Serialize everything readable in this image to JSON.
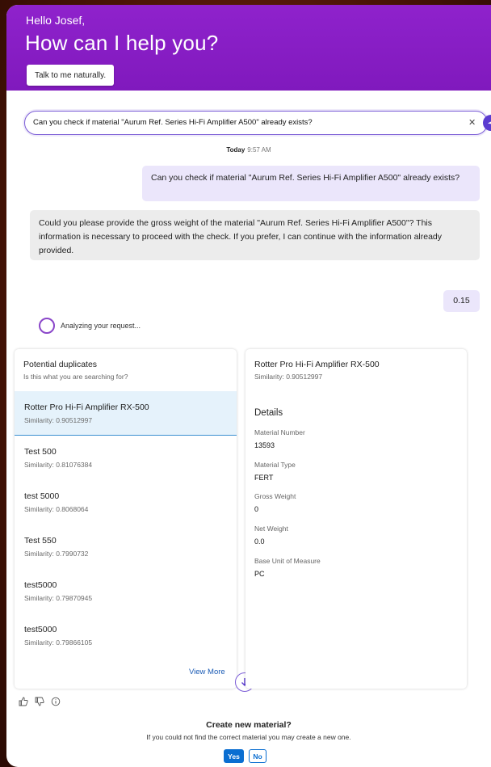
{
  "header": {
    "greeting": "Hello Josef,",
    "headline": "How can I help you?",
    "talk_button": "Talk to me naturally."
  },
  "search": {
    "value": "Can you check if material \"Aurum Ref. Series Hi-Fi Amplifier A500\" already exists?"
  },
  "conversation": {
    "day": "Today",
    "time": "9:57 AM",
    "user_message": "Can you check if material \"Aurum Ref. Series Hi-Fi Amplifier A500\" already exists?",
    "bot_message": "Could you please provide the gross weight of the material \"Aurum Ref. Series Hi-Fi Amplifier A500\"? This information is necessary to proceed with the check. If you prefer, I can continue with the information already provided.",
    "user_reply": "0.15",
    "status": "Analyzing your request..."
  },
  "duplicates": {
    "title": "Potential duplicates",
    "subtitle": "Is this what you are searching for?",
    "items": [
      {
        "name": "Rotter Pro Hi-Fi Amplifier RX-500",
        "similarity": "Similarity: 0.90512997"
      },
      {
        "name": "Test 500",
        "similarity": "Similarity: 0.81076384"
      },
      {
        "name": "test 5000",
        "similarity": "Similarity: 0.8068064"
      },
      {
        "name": "Test 550",
        "similarity": "Similarity: 0.7990732"
      },
      {
        "name": "test5000",
        "similarity": "Similarity: 0.79870945"
      },
      {
        "name": "test5000",
        "similarity": "Similarity: 0.79866105"
      }
    ],
    "view_more": "View More"
  },
  "details": {
    "title": "Rotter Pro Hi-Fi Amplifier RX-500",
    "subtitle": "Similarity: 0.90512997",
    "heading": "Details",
    "fields": [
      {
        "label": "Material Number",
        "value": "13593"
      },
      {
        "label": "Material Type",
        "value": "FERT"
      },
      {
        "label": "Gross Weight",
        "value": "0"
      },
      {
        "label": "Net Weight",
        "value": "0.0"
      },
      {
        "label": "Base Unit of Measure",
        "value": "PC"
      }
    ]
  },
  "create": {
    "title": "Create new material?",
    "subtitle": "If you could not find the correct material you may create a new one.",
    "yes": "Yes",
    "no": "No"
  },
  "colors": {
    "header_purple": "#8a1fc4",
    "accent": "#5b3bd0",
    "link_blue": "#1a5bb5",
    "button_blue": "#0a6ed1"
  },
  "icons": [
    "clear-icon",
    "send-icon",
    "spinner-icon",
    "arrow-down-icon",
    "thumbs-up-icon",
    "thumbs-down-icon",
    "info-icon"
  ]
}
